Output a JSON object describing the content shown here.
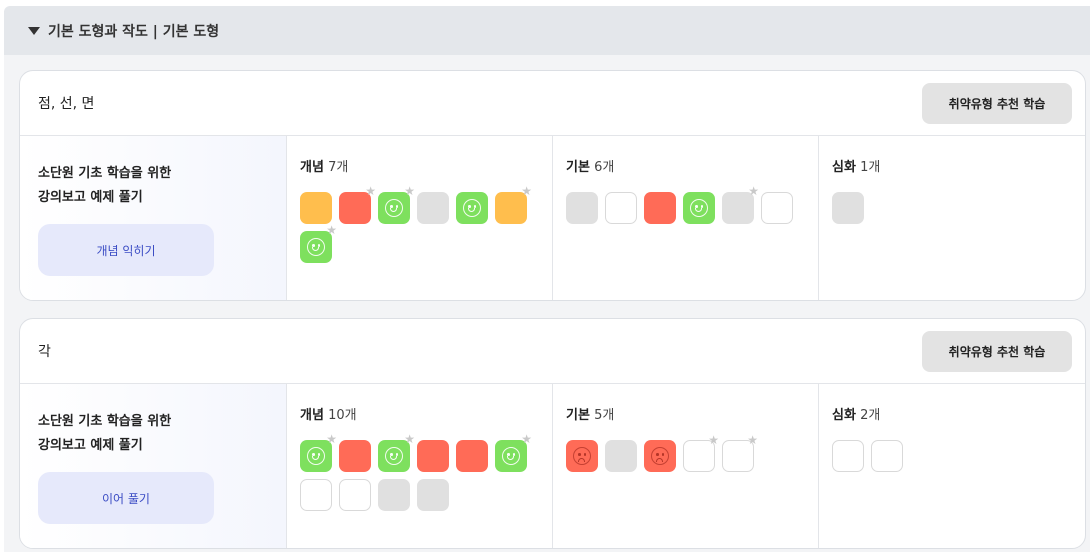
{
  "header": {
    "title": "기본 도형과 작도  |  기본 도형"
  },
  "cards": [
    {
      "title": "점, 선, 면",
      "recommend_label": "취약유형 추천 학습",
      "lead_text_1": "소단원 기초 학습을 위한",
      "lead_text_2": "강의보고 예제 풀기",
      "lead_button": "개념 익히기",
      "levels": [
        {
          "label": "개념",
          "count": "7개",
          "tiles": [
            {
              "state": "orange",
              "face": "none",
              "star": false
            },
            {
              "state": "red",
              "face": "none",
              "star": true
            },
            {
              "state": "green",
              "face": "smile",
              "star": true
            },
            {
              "state": "gray",
              "face": "none",
              "star": false
            },
            {
              "state": "green",
              "face": "smile",
              "star": false
            },
            {
              "state": "orange",
              "face": "none",
              "star": true
            },
            {
              "state": "green",
              "face": "smile",
              "star": true
            }
          ]
        },
        {
          "label": "기본",
          "count": "6개",
          "tiles": [
            {
              "state": "gray",
              "face": "none",
              "star": false
            },
            {
              "state": "empty",
              "face": "none",
              "star": false
            },
            {
              "state": "red",
              "face": "none",
              "star": false
            },
            {
              "state": "green",
              "face": "smile",
              "star": false
            },
            {
              "state": "gray",
              "face": "none",
              "star": true
            },
            {
              "state": "empty",
              "face": "none",
              "star": false
            }
          ]
        },
        {
          "label": "심화",
          "count": "1개",
          "tiles": [
            {
              "state": "gray",
              "face": "none",
              "star": false
            }
          ]
        }
      ]
    },
    {
      "title": "각",
      "recommend_label": "취약유형 추천 학습",
      "lead_text_1": "소단원 기초 학습을 위한",
      "lead_text_2": "강의보고 예제 풀기",
      "lead_button": "이어 풀기",
      "levels": [
        {
          "label": "개념",
          "count": "10개",
          "tiles": [
            {
              "state": "green",
              "face": "smile",
              "star": true
            },
            {
              "state": "red",
              "face": "none",
              "star": false
            },
            {
              "state": "green",
              "face": "smile",
              "star": true
            },
            {
              "state": "red",
              "face": "none",
              "star": false
            },
            {
              "state": "red",
              "face": "none",
              "star": false
            },
            {
              "state": "green",
              "face": "smile",
              "star": true
            },
            {
              "state": "empty",
              "face": "none",
              "star": false
            },
            {
              "state": "empty",
              "face": "none",
              "star": false
            },
            {
              "state": "gray",
              "face": "none",
              "star": false
            },
            {
              "state": "gray",
              "face": "none",
              "star": false
            }
          ]
        },
        {
          "label": "기본",
          "count": "5개",
          "tiles": [
            {
              "state": "red",
              "face": "sad",
              "star": false
            },
            {
              "state": "gray",
              "face": "none",
              "star": false
            },
            {
              "state": "red",
              "face": "sad",
              "star": false
            },
            {
              "state": "empty",
              "face": "none",
              "star": true
            },
            {
              "state": "empty",
              "face": "none",
              "star": true
            }
          ]
        },
        {
          "label": "심화",
          "count": "2개",
          "tiles": [
            {
              "state": "empty",
              "face": "none",
              "star": false
            },
            {
              "state": "empty",
              "face": "none",
              "star": false
            }
          ]
        }
      ]
    }
  ],
  "colors": {
    "orange": "#ffbe4d",
    "red": "#ff6b57",
    "green": "#7ee05e",
    "gray": "#e0e0e0",
    "accent": "#3b4cc4"
  }
}
